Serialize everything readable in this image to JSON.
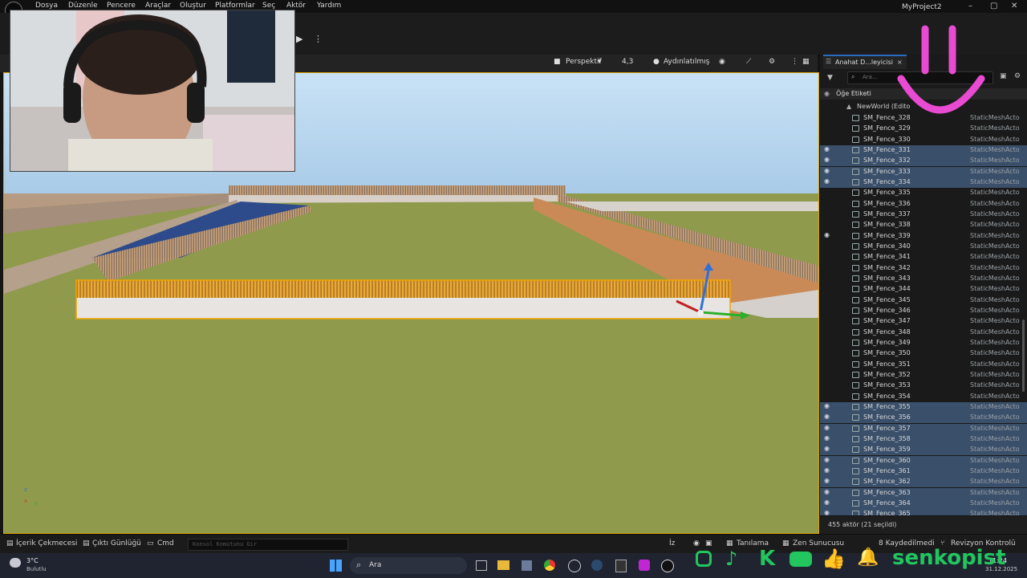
{
  "menu": [
    "Dosya",
    "Düzenle",
    "Pencere",
    "Araçlar",
    "Oluştur",
    "Platformlar",
    "Seç",
    "Aktör",
    "Yardım"
  ],
  "window_title": "MyProject2",
  "viewport": {
    "perspective": "Perspektif",
    "speed": "4,3",
    "lit": "Aydınlatılmış"
  },
  "outliner": {
    "tab": "Anahat D...leyicisi",
    "search_placeholder": "Ara...",
    "col_label": "Öğe Etiketi",
    "world": "NewWorld (Edito",
    "actor_type": "StaticMeshActo",
    "rows": [
      {
        "name": "SM_Fence_328",
        "sel": false,
        "eye": false
      },
      {
        "name": "SM_Fence_329",
        "sel": false,
        "eye": false
      },
      {
        "name": "SM_Fence_330",
        "sel": false,
        "eye": false
      },
      {
        "name": "SM_Fence_331",
        "sel": true,
        "eye": true
      },
      {
        "name": "SM_Fence_332",
        "sel": true,
        "eye": true
      },
      {
        "name": "SM_Fence_333",
        "sel": true,
        "eye": true
      },
      {
        "name": "SM_Fence_334",
        "sel": true,
        "eye": true
      },
      {
        "name": "SM_Fence_335",
        "sel": false,
        "eye": false
      },
      {
        "name": "SM_Fence_336",
        "sel": false,
        "eye": false
      },
      {
        "name": "SM_Fence_337",
        "sel": false,
        "eye": false
      },
      {
        "name": "SM_Fence_338",
        "sel": false,
        "eye": false
      },
      {
        "name": "SM_Fence_339",
        "sel": false,
        "eye": true
      },
      {
        "name": "SM_Fence_340",
        "sel": false,
        "eye": false
      },
      {
        "name": "SM_Fence_341",
        "sel": false,
        "eye": false
      },
      {
        "name": "SM_Fence_342",
        "sel": false,
        "eye": false
      },
      {
        "name": "SM_Fence_343",
        "sel": false,
        "eye": false
      },
      {
        "name": "SM_Fence_344",
        "sel": false,
        "eye": false
      },
      {
        "name": "SM_Fence_345",
        "sel": false,
        "eye": false
      },
      {
        "name": "SM_Fence_346",
        "sel": false,
        "eye": false
      },
      {
        "name": "SM_Fence_347",
        "sel": false,
        "eye": false
      },
      {
        "name": "SM_Fence_348",
        "sel": false,
        "eye": false
      },
      {
        "name": "SM_Fence_349",
        "sel": false,
        "eye": false
      },
      {
        "name": "SM_Fence_350",
        "sel": false,
        "eye": false
      },
      {
        "name": "SM_Fence_351",
        "sel": false,
        "eye": false
      },
      {
        "name": "SM_Fence_352",
        "sel": false,
        "eye": false
      },
      {
        "name": "SM_Fence_353",
        "sel": false,
        "eye": false
      },
      {
        "name": "SM_Fence_354",
        "sel": false,
        "eye": false
      },
      {
        "name": "SM_Fence_355",
        "sel": true,
        "eye": true
      },
      {
        "name": "SM_Fence_356",
        "sel": true,
        "eye": true
      },
      {
        "name": "SM_Fence_357",
        "sel": true,
        "eye": true
      },
      {
        "name": "SM_Fence_358",
        "sel": true,
        "eye": true
      },
      {
        "name": "SM_Fence_359",
        "sel": true,
        "eye": true
      },
      {
        "name": "SM_Fence_360",
        "sel": true,
        "eye": true
      },
      {
        "name": "SM_Fence_361",
        "sel": true,
        "eye": true
      },
      {
        "name": "SM_Fence_362",
        "sel": true,
        "eye": true
      },
      {
        "name": "SM_Fence_363",
        "sel": true,
        "eye": true
      },
      {
        "name": "SM_Fence_364",
        "sel": true,
        "eye": true
      },
      {
        "name": "SM_Fence_365",
        "sel": true,
        "eye": true
      }
    ],
    "footer": "455 aktör (21 seçildi)"
  },
  "statusbar": {
    "content_drawer": "İçerik Çekmecesi",
    "output_log": "Çıktı Günlüğü",
    "cmd": "Cmd",
    "cmd_placeholder": "Konsol Komutunu Gir",
    "trace": "İz",
    "derived": "Tanılama",
    "zen": "Zen Sunucusu",
    "saved": "8 Kaydedilmedi",
    "revision": "Revizyon Kontrolü"
  },
  "taskbar": {
    "weather_temp": "3°C",
    "weather_desc": "Bulutlu",
    "search": "Ara",
    "time": "11:24",
    "date": "31.12.2025"
  },
  "overlay": {
    "handle": "senkopist"
  },
  "colors": {
    "accent_selection": "#3a4f6a",
    "fence": "#e7a53a",
    "ground": "#8f9a4c",
    "sky": "#a9cbe8",
    "overlay_pink": "#e84bd2",
    "social_green": "#22c55e"
  }
}
